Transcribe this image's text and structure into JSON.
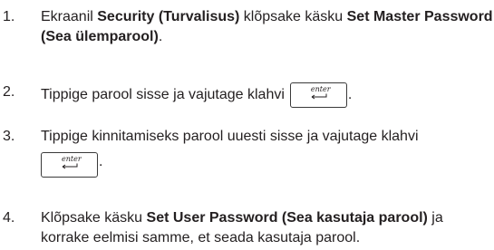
{
  "steps": [
    {
      "number": "1.",
      "prefix": "Ekraanil ",
      "bold1": "Security (Turvalisus)",
      "middle": " klõpsake käsku ",
      "bold2": "Set Master Password (Sea ülemparool)",
      "suffix": "."
    },
    {
      "number": "2.",
      "text": "Tippige parool sisse ja vajutage klahvi",
      "key_label": "enter",
      "suffix": "."
    },
    {
      "number": "3.",
      "text": "Tippige kinnitamiseks parool uuesti sisse ja vajutage klahvi",
      "key_label": "enter",
      "suffix": "."
    },
    {
      "number": "4.",
      "prefix": "Klõpsake käsku ",
      "bold1": "Set User Password (Sea kasutaja parool)",
      "suffix": " ja korrake eelmisi samme, et seada kasutaja parool."
    }
  ],
  "icons": {
    "enter_key_arrow": "return-arrow-icon"
  }
}
